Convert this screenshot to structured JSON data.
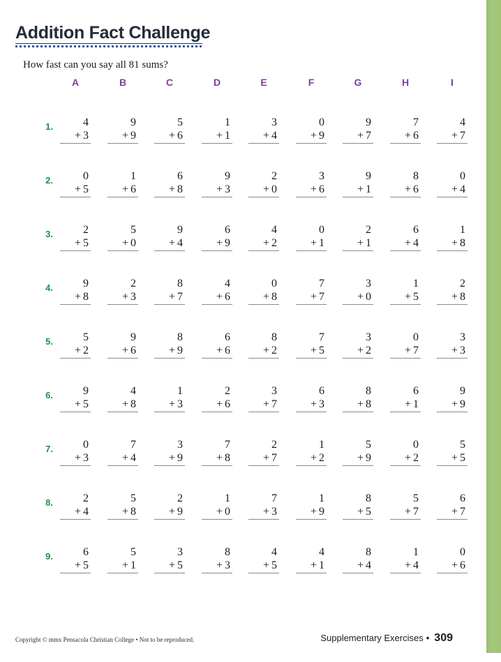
{
  "page": {
    "title": "Addition Fact Challenge",
    "instruction": "How fast can you say all 81 sums?",
    "accent_title_color": "#242c38",
    "accent_dots_color": "#2b54a6",
    "accent_header_color": "#7b3fa0",
    "accent_number_color": "#1a9443",
    "edge_band_color": "#a2c276"
  },
  "grid": {
    "column_headers": [
      "A",
      "B",
      "C",
      "D",
      "E",
      "F",
      "G",
      "H",
      "I"
    ],
    "row_labels": [
      "1.",
      "2.",
      "3.",
      "4.",
      "5.",
      "6.",
      "7.",
      "8.",
      "9."
    ],
    "operator": "+",
    "rows": [
      {
        "label": "1.",
        "problems": [
          {
            "top": "4",
            "op": "+",
            "addend": "3"
          },
          {
            "top": "9",
            "op": "+",
            "addend": "9"
          },
          {
            "top": "5",
            "op": "+",
            "addend": "6"
          },
          {
            "top": "1",
            "op": "+",
            "addend": "1"
          },
          {
            "top": "3",
            "op": "+",
            "addend": "4"
          },
          {
            "top": "0",
            "op": "+",
            "addend": "9"
          },
          {
            "top": "9",
            "op": "+",
            "addend": "7"
          },
          {
            "top": "7",
            "op": "+",
            "addend": "6"
          },
          {
            "top": "4",
            "op": "+",
            "addend": "7"
          }
        ]
      },
      {
        "label": "2.",
        "problems": [
          {
            "top": "0",
            "op": "+",
            "addend": "5"
          },
          {
            "top": "1",
            "op": "+",
            "addend": "6"
          },
          {
            "top": "6",
            "op": "+",
            "addend": "8"
          },
          {
            "top": "9",
            "op": "+",
            "addend": "3"
          },
          {
            "top": "2",
            "op": "+",
            "addend": "0"
          },
          {
            "top": "3",
            "op": "+",
            "addend": "6"
          },
          {
            "top": "9",
            "op": "+",
            "addend": "1"
          },
          {
            "top": "8",
            "op": "+",
            "addend": "6"
          },
          {
            "top": "0",
            "op": "+",
            "addend": "4"
          }
        ]
      },
      {
        "label": "3.",
        "problems": [
          {
            "top": "2",
            "op": "+",
            "addend": "5"
          },
          {
            "top": "5",
            "op": "+",
            "addend": "0"
          },
          {
            "top": "9",
            "op": "+",
            "addend": "4"
          },
          {
            "top": "6",
            "op": "+",
            "addend": "9"
          },
          {
            "top": "4",
            "op": "+",
            "addend": "2"
          },
          {
            "top": "0",
            "op": "+",
            "addend": "1"
          },
          {
            "top": "2",
            "op": "+",
            "addend": "1"
          },
          {
            "top": "6",
            "op": "+",
            "addend": "4"
          },
          {
            "top": "1",
            "op": "+",
            "addend": "8"
          }
        ]
      },
      {
        "label": "4.",
        "problems": [
          {
            "top": "9",
            "op": "+",
            "addend": "8"
          },
          {
            "top": "2",
            "op": "+",
            "addend": "3"
          },
          {
            "top": "8",
            "op": "+",
            "addend": "7"
          },
          {
            "top": "4",
            "op": "+",
            "addend": "6"
          },
          {
            "top": "0",
            "op": "+",
            "addend": "8"
          },
          {
            "top": "7",
            "op": "+",
            "addend": "7"
          },
          {
            "top": "3",
            "op": "+",
            "addend": "0"
          },
          {
            "top": "1",
            "op": "+",
            "addend": "5"
          },
          {
            "top": "2",
            "op": "+",
            "addend": "8"
          }
        ]
      },
      {
        "label": "5.",
        "problems": [
          {
            "top": "5",
            "op": "+",
            "addend": "2"
          },
          {
            "top": "9",
            "op": "+",
            "addend": "6"
          },
          {
            "top": "8",
            "op": "+",
            "addend": "9"
          },
          {
            "top": "6",
            "op": "+",
            "addend": "6"
          },
          {
            "top": "8",
            "op": "+",
            "addend": "2"
          },
          {
            "top": "7",
            "op": "+",
            "addend": "5"
          },
          {
            "top": "3",
            "op": "+",
            "addend": "2"
          },
          {
            "top": "0",
            "op": "+",
            "addend": "7"
          },
          {
            "top": "3",
            "op": "+",
            "addend": "3"
          }
        ]
      },
      {
        "label": "6.",
        "problems": [
          {
            "top": "9",
            "op": "+",
            "addend": "5"
          },
          {
            "top": "4",
            "op": "+",
            "addend": "8"
          },
          {
            "top": "1",
            "op": "+",
            "addend": "3"
          },
          {
            "top": "2",
            "op": "+",
            "addend": "6"
          },
          {
            "top": "3",
            "op": "+",
            "addend": "7"
          },
          {
            "top": "6",
            "op": "+",
            "addend": "3"
          },
          {
            "top": "8",
            "op": "+",
            "addend": "8"
          },
          {
            "top": "6",
            "op": "+",
            "addend": "1"
          },
          {
            "top": "9",
            "op": "+",
            "addend": "9"
          }
        ]
      },
      {
        "label": "7.",
        "problems": [
          {
            "top": "0",
            "op": "+",
            "addend": "3"
          },
          {
            "top": "7",
            "op": "+",
            "addend": "4"
          },
          {
            "top": "3",
            "op": "+",
            "addend": "9"
          },
          {
            "top": "7",
            "op": "+",
            "addend": "8"
          },
          {
            "top": "2",
            "op": "+",
            "addend": "7"
          },
          {
            "top": "1",
            "op": "+",
            "addend": "2"
          },
          {
            "top": "5",
            "op": "+",
            "addend": "9"
          },
          {
            "top": "0",
            "op": "+",
            "addend": "2"
          },
          {
            "top": "5",
            "op": "+",
            "addend": "5"
          }
        ]
      },
      {
        "label": "8.",
        "problems": [
          {
            "top": "2",
            "op": "+",
            "addend": "4"
          },
          {
            "top": "5",
            "op": "+",
            "addend": "8"
          },
          {
            "top": "2",
            "op": "+",
            "addend": "9"
          },
          {
            "top": "1",
            "op": "+",
            "addend": "0"
          },
          {
            "top": "7",
            "op": "+",
            "addend": "3"
          },
          {
            "top": "1",
            "op": "+",
            "addend": "9"
          },
          {
            "top": "8",
            "op": "+",
            "addend": "5"
          },
          {
            "top": "5",
            "op": "+",
            "addend": "7"
          },
          {
            "top": "6",
            "op": "+",
            "addend": "7"
          }
        ]
      },
      {
        "label": "9.",
        "problems": [
          {
            "top": "6",
            "op": "+",
            "addend": "5"
          },
          {
            "top": "5",
            "op": "+",
            "addend": "1"
          },
          {
            "top": "3",
            "op": "+",
            "addend": "5"
          },
          {
            "top": "8",
            "op": "+",
            "addend": "3"
          },
          {
            "top": "4",
            "op": "+",
            "addend": "5"
          },
          {
            "top": "4",
            "op": "+",
            "addend": "1"
          },
          {
            "top": "8",
            "op": "+",
            "addend": "4"
          },
          {
            "top": "1",
            "op": "+",
            "addend": "4"
          },
          {
            "top": "0",
            "op": "+",
            "addend": "6"
          }
        ]
      }
    ]
  },
  "footer": {
    "copyright": "Copyright © mmx  Pensacola Christian College • Not to be reproduced.",
    "section": "Supplementary Exercises",
    "separator": "•",
    "page_number": "309"
  }
}
